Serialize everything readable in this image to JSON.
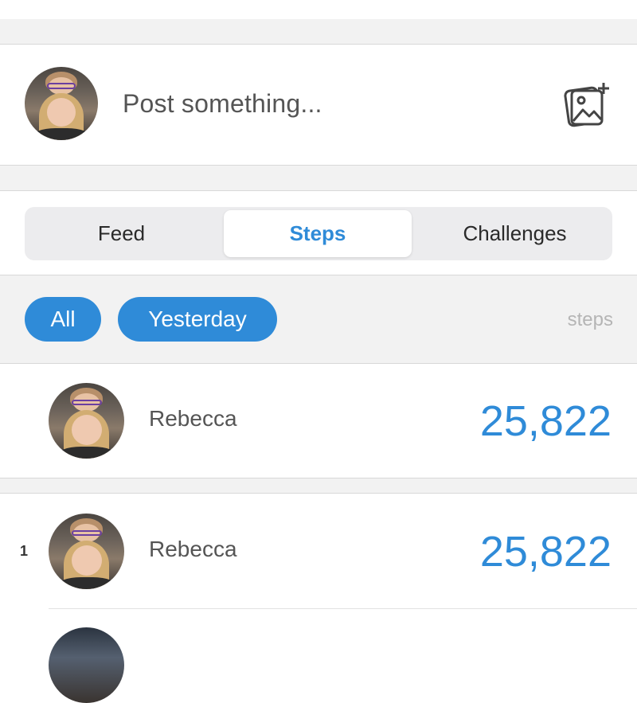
{
  "composer": {
    "placeholder": "Post something...",
    "photo_icon": "add-photo-icon"
  },
  "tabs": [
    {
      "label": "Feed",
      "active": false
    },
    {
      "label": "Steps",
      "active": true
    },
    {
      "label": "Challenges",
      "active": false
    }
  ],
  "filters": {
    "all_label": "All",
    "period_label": "Yesterday",
    "unit_label": "steps"
  },
  "my_stats": {
    "name": "Rebecca",
    "steps": "25,822"
  },
  "leaderboard": [
    {
      "rank": "1",
      "name": "Rebecca",
      "steps": "25,822"
    }
  ],
  "colors": {
    "accent": "#2f8bd8",
    "background_band": "#f2f2f2"
  }
}
